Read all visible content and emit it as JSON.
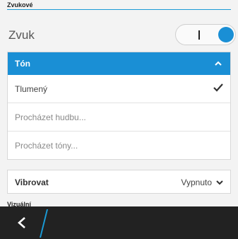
{
  "section_sounds": {
    "title": "Zvukové"
  },
  "sound": {
    "label": "Zvuk",
    "toggle_on": true,
    "toggle_mark": "I"
  },
  "tone": {
    "label": "Tón",
    "options": [
      {
        "label": "Tlumený",
        "selected": true
      },
      {
        "label": "Procházet hudbu..."
      },
      {
        "label": "Procházet tóny..."
      }
    ]
  },
  "vibrate": {
    "label": "Vibrovat",
    "value": "Vypnuto"
  },
  "section_next": {
    "title": "Vizuální"
  },
  "colors": {
    "accent": "#1a8fd5",
    "bar": "#222222"
  },
  "icons": {
    "chevron_up": "chevron-up-icon",
    "checkmark": "checkmark-icon",
    "chevron_down": "chevron-down-icon",
    "back": "back-arrow-icon"
  }
}
